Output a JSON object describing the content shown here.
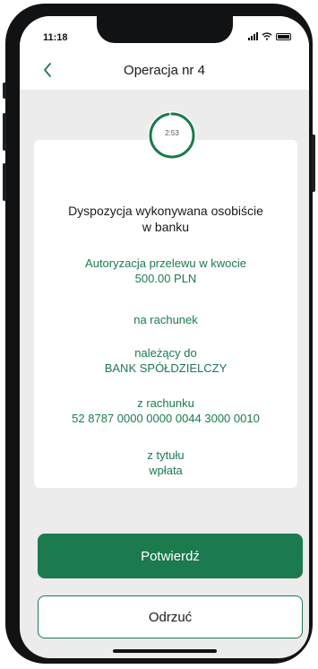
{
  "status_bar": {
    "time": "11:18"
  },
  "header": {
    "title": "Operacja nr 4",
    "back_icon": "chevron-left-icon"
  },
  "timer": {
    "text": "2:53",
    "remaining_fraction": 0.97,
    "color": "#1b7a4e"
  },
  "card": {
    "heading_line1": "Dyspozycja wykonywana osobiście",
    "heading_line2": "w banku",
    "auth_line1": "Autoryzacja przelewu w kwocie",
    "amount": "500.00 PLN",
    "to_account_label": "na rachunek",
    "owner_label": "należący do",
    "owner_name": "BANK SPÓŁDZIELCZY",
    "from_account_label": "z rachunku",
    "from_account_number": "52 8787 0000 0000 0044 3000 0010",
    "title_label": "z tytułu",
    "title_value": "wpłata"
  },
  "actions": {
    "confirm_label": "Potwierdź",
    "reject_label": "Odrzuć"
  },
  "colors": {
    "accent": "#1b7a4e",
    "background": "#ececec"
  }
}
